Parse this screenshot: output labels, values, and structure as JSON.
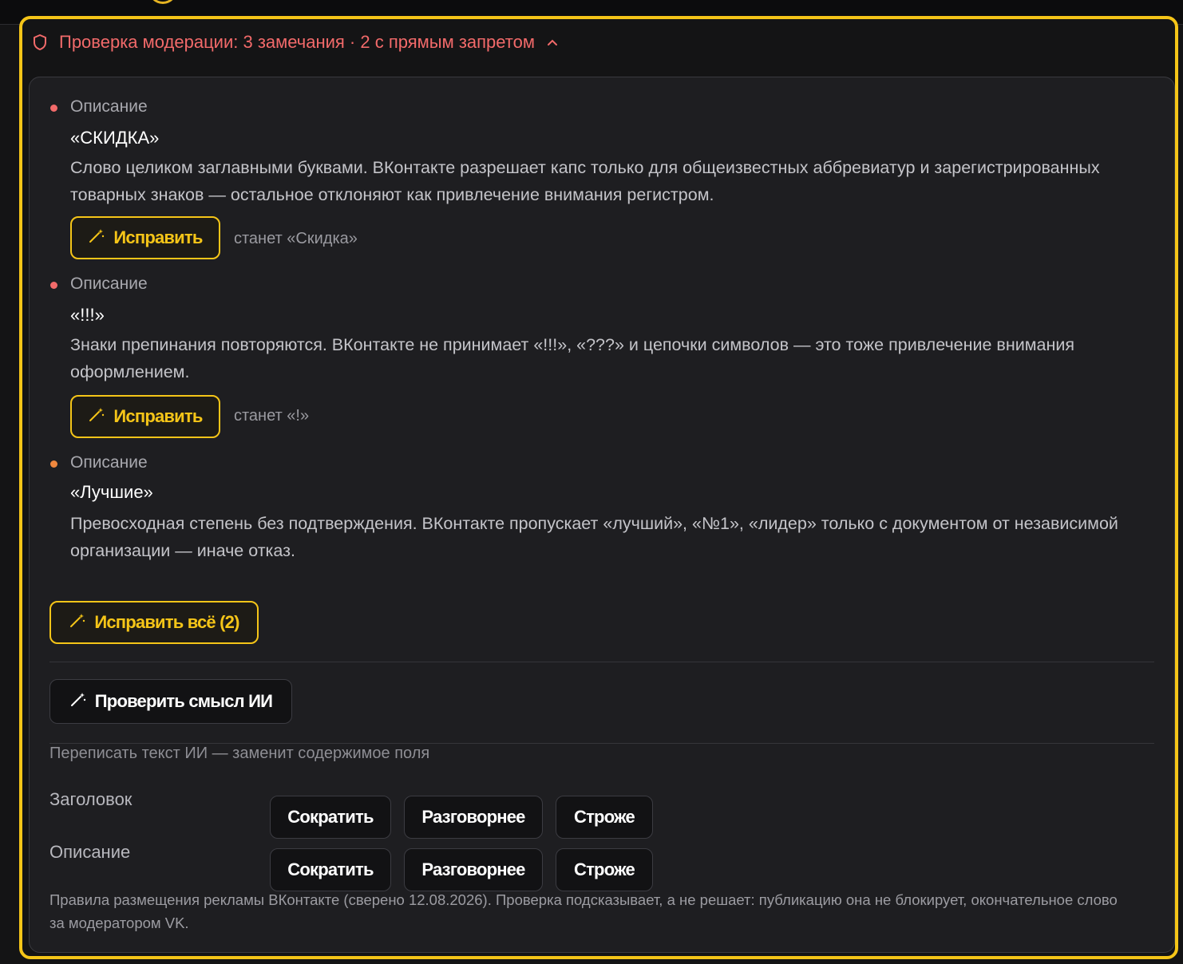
{
  "header": {
    "title": "Проверка модерации: 3 замечания · 2 с прямым запретом",
    "colors": {
      "alert": "#f26a6a",
      "accent": "#f5c518"
    }
  },
  "issues": [
    {
      "field": "Описание",
      "word": "«СКИДКА»",
      "severity_color": "#f26a6a",
      "description": "Слово целиком заглавными буквами. ВКонтакте разрешает капс только для общеизвестных аббревиатур и зарегистрированных товарных знаков — остальное отклоняют как привлечение внимания регистром.",
      "fix_label": "Исправить",
      "becomes": "станет «Скидка»"
    },
    {
      "field": "Описание",
      "word": "«!!!»",
      "severity_color": "#f26a6a",
      "description": "Знаки препинания повторяются. ВКонтакте не принимает «!!!», «???» и цепочки символов — это тоже привлечение внимания оформлением.",
      "fix_label": "Исправить",
      "becomes": "станет «!»"
    },
    {
      "field": "Описание",
      "word": "«Лучшие»",
      "severity_color": "#f0883e",
      "description": "Превосходная степень без подтверждения. ВКонтакте пропускает «лучший», «№1», «лидер» только с документом от независимой организации — иначе отказ."
    }
  ],
  "fix_all_label": "Исправить всё (2)",
  "check_meaning_label": "Проверить смысл ИИ",
  "rewrite": {
    "label": "Переписать текст ИИ — заменит содержимое поля",
    "rows": [
      {
        "label": "Заголовок",
        "buttons": [
          "Сократить",
          "Разговорнее",
          "Строже"
        ]
      },
      {
        "label": "Описание",
        "buttons": [
          "Сократить",
          "Разговорнее",
          "Строже"
        ]
      }
    ]
  },
  "footer": "Правила размещения рекламы ВКонтакте (сверено 12.08.2026). Проверка подсказывает, а не решает: публикацию она не блокирует, окончательное слово за модератором VK.",
  "icons": [
    "shield-icon",
    "chevron-up-icon",
    "magic-wand-icon"
  ]
}
